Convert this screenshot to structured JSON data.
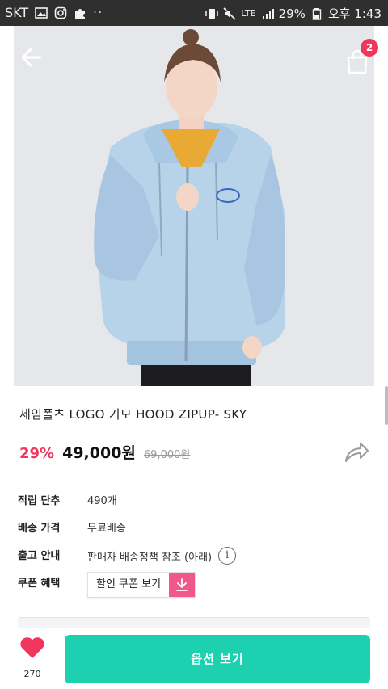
{
  "status_bar": {
    "carrier": "SKT",
    "network": "LTE",
    "battery": "29%",
    "time": "오후 1:43",
    "icons": [
      "image-icon",
      "instagram-icon",
      "puzzle-icon",
      "more-dots-icon",
      "vibrate-icon",
      "mute-icon",
      "signal-icon",
      "battery-icon"
    ]
  },
  "header": {
    "back_icon": "arrow-left-icon",
    "cart_icon": "shopping-bag-icon",
    "cart_count": "2"
  },
  "product": {
    "title": "세임폴츠 LOGO 기모 HOOD ZIPUP- SKY",
    "discount": "29%",
    "price": "49,000원",
    "original_price": "69,000원",
    "image_desc_colors": {
      "hoodie": "#b7d3ea",
      "background": "#e5e6ea"
    }
  },
  "info": {
    "points_label": "적립 단추",
    "points_value": "490개",
    "shipping_label": "배송 가격",
    "shipping_value": "무료배송",
    "release_label": "출고 안내",
    "release_value": "판매자 배송정책 참조 (아래)",
    "release_info_icon": "i",
    "coupon_label": "쿠폰 혜택",
    "coupon_button": "할인 쿠폰 보기"
  },
  "bottom_bar": {
    "like_count": "270",
    "option_button": "옵션 보기"
  },
  "colors": {
    "accent_pink": "#f0365d",
    "teal": "#1dd0b0",
    "status_bar": "#2f2f2f"
  }
}
